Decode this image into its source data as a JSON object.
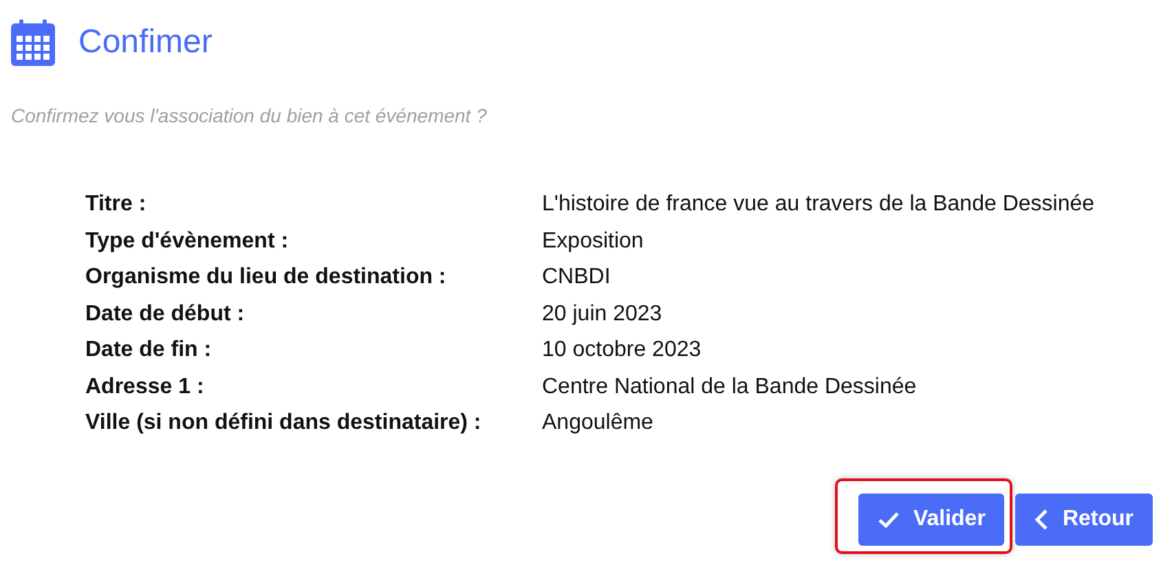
{
  "header": {
    "title": "Confimer"
  },
  "message": "Confirmez vous l'association du bien à cet événement ?",
  "details": [
    {
      "label": "Titre :",
      "value": "L'histoire de france vue au travers de la Bande Dessinée"
    },
    {
      "label": "Type d'évènement :",
      "value": "Exposition"
    },
    {
      "label": "Organisme du lieu de destination :",
      "value": "CNBDI"
    },
    {
      "label": "Date de début :",
      "value": "20 juin 2023"
    },
    {
      "label": "Date de fin :",
      "value": "10 octobre 2023"
    },
    {
      "label": "Adresse 1 :",
      "value": "Centre National de la Bande Dessinée"
    },
    {
      "label": "Ville (si non défini dans destinataire) :",
      "value": "Angoulême"
    }
  ],
  "buttons": [
    {
      "kind": "confirm",
      "label": "Valider",
      "highlighted": true
    },
    {
      "kind": "back",
      "label": "Retour",
      "highlighted": false
    }
  ]
}
